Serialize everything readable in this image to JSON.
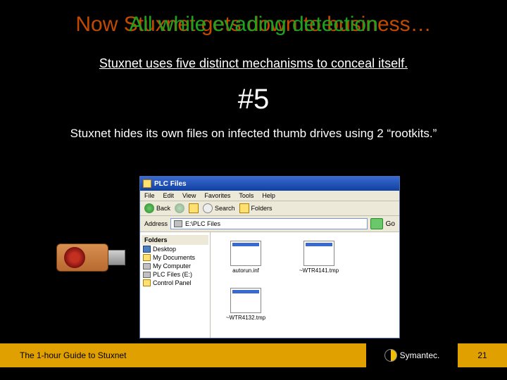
{
  "titles": {
    "back": "Now Stuxnet gets down to business…",
    "front": "All while evading detection"
  },
  "subtitle": "Stuxnet uses five distinct mechanisms to conceal itself.",
  "mechanism_number": "#5",
  "description": "Stuxnet hides its own files on infected thumb drives using 2 “rootkits.”",
  "explorer": {
    "title": "PLC Files",
    "menu": [
      "File",
      "Edit",
      "View",
      "Favorites",
      "Tools",
      "Help"
    ],
    "toolbar": {
      "back": "Back",
      "search": "Search",
      "folders": "Folders"
    },
    "address_label": "Address",
    "address_value": "E:\\PLC Files",
    "go": "Go",
    "tree_header": "Folders",
    "tree": [
      "Desktop",
      "My Documents",
      "My Computer",
      "PLC Files (E:)",
      "Control Panel"
    ],
    "files": [
      "autorun.inf",
      "~WTR4141.tmp",
      "~WTR4132.tmp"
    ]
  },
  "footer": {
    "guide": "The 1-hour Guide to Stuxnet",
    "brand": "Symantec.",
    "page": "21"
  }
}
